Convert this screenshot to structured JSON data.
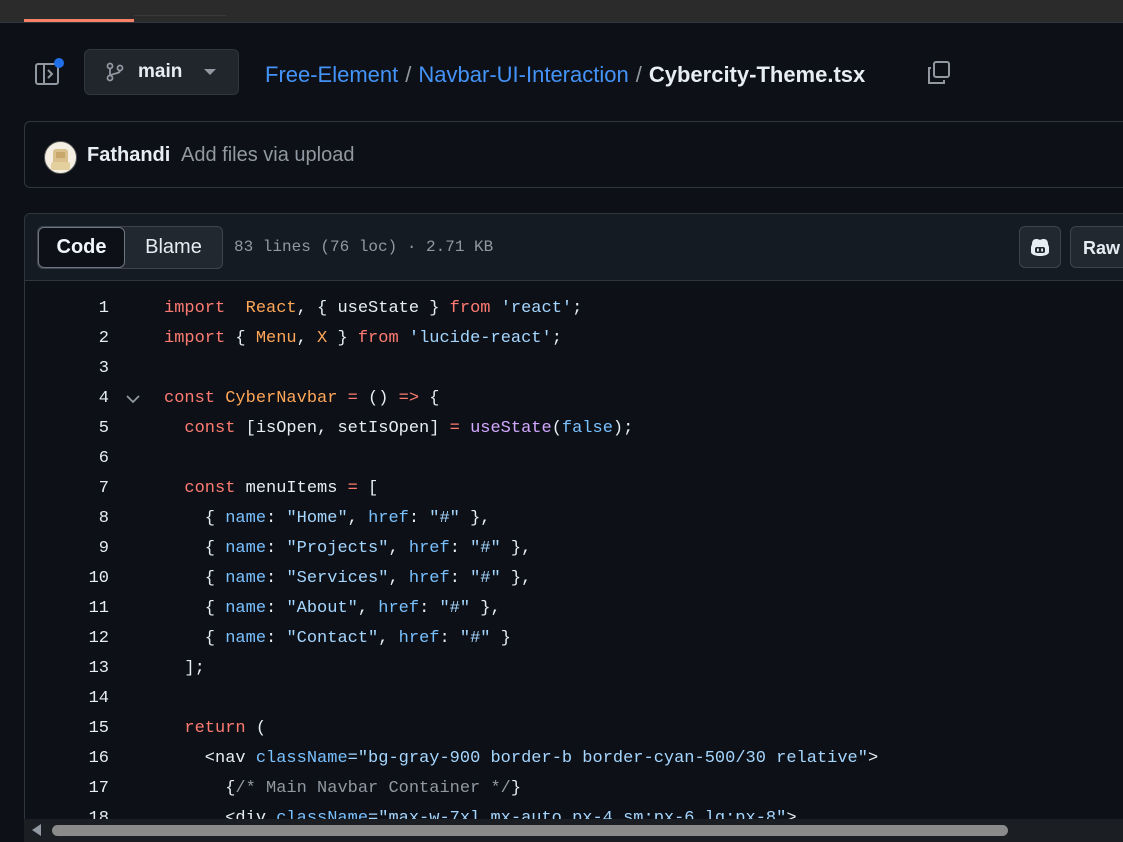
{
  "branch": {
    "name": "main"
  },
  "breadcrumb": {
    "repo": "Free-Element",
    "folder": "Navbar-UI-Interaction",
    "file": "Cybercity-Theme.tsx",
    "separator": "/"
  },
  "commit": {
    "author": "Fathandi",
    "message": "Add files via upload"
  },
  "file_header": {
    "tabs": [
      "Code",
      "Blame"
    ],
    "active_tab": "Code",
    "meta": "83 lines (76 loc) · 2.71 KB",
    "raw_label": "Raw"
  },
  "code": {
    "lines": [
      {
        "n": "1",
        "foldable": false,
        "tokens": [
          [
            "kw",
            "import"
          ],
          [
            "",
            "  "
          ],
          [
            "var",
            "React"
          ],
          [
            "",
            ", { useState } "
          ],
          [
            "kw",
            "from"
          ],
          [
            "",
            " "
          ],
          [
            "str",
            "'react'"
          ],
          [
            "",
            ";"
          ]
        ]
      },
      {
        "n": "2",
        "foldable": false,
        "tokens": [
          [
            "kw",
            "import"
          ],
          [
            "",
            " { "
          ],
          [
            "var",
            "Menu"
          ],
          [
            "",
            ", "
          ],
          [
            "var",
            "X"
          ],
          [
            "",
            " } "
          ],
          [
            "kw",
            "from"
          ],
          [
            "",
            " "
          ],
          [
            "str",
            "'lucide-react'"
          ],
          [
            "",
            ";"
          ]
        ]
      },
      {
        "n": "3",
        "foldable": false,
        "tokens": []
      },
      {
        "n": "4",
        "foldable": true,
        "tokens": [
          [
            "kw",
            "const"
          ],
          [
            "",
            " "
          ],
          [
            "var",
            "CyberNavbar"
          ],
          [
            "",
            " "
          ],
          [
            "kw",
            "="
          ],
          [
            "",
            " () "
          ],
          [
            "kw",
            "=>"
          ],
          [
            "",
            " {"
          ]
        ]
      },
      {
        "n": "5",
        "foldable": false,
        "tokens": [
          [
            "",
            "  "
          ],
          [
            "kw",
            "const"
          ],
          [
            "",
            " [isOpen, setIsOpen] "
          ],
          [
            "kw",
            "="
          ],
          [
            "",
            " "
          ],
          [
            "fn",
            "useState"
          ],
          [
            "",
            "("
          ],
          [
            "prop",
            "false"
          ],
          [
            "",
            ");"
          ]
        ]
      },
      {
        "n": "6",
        "foldable": false,
        "tokens": []
      },
      {
        "n": "7",
        "foldable": false,
        "tokens": [
          [
            "",
            "  "
          ],
          [
            "kw",
            "const"
          ],
          [
            "",
            " menuItems "
          ],
          [
            "kw",
            "="
          ],
          [
            "",
            " ["
          ]
        ]
      },
      {
        "n": "8",
        "foldable": false,
        "tokens": [
          [
            "",
            "    { "
          ],
          [
            "prop",
            "name"
          ],
          [
            "",
            ": "
          ],
          [
            "str",
            "\"Home\""
          ],
          [
            "",
            ", "
          ],
          [
            "prop",
            "href"
          ],
          [
            "",
            ": "
          ],
          [
            "str",
            "\"#\""
          ],
          [
            "",
            " },"
          ]
        ]
      },
      {
        "n": "9",
        "foldable": false,
        "tokens": [
          [
            "",
            "    { "
          ],
          [
            "prop",
            "name"
          ],
          [
            "",
            ": "
          ],
          [
            "str",
            "\"Projects\""
          ],
          [
            "",
            ", "
          ],
          [
            "prop",
            "href"
          ],
          [
            "",
            ": "
          ],
          [
            "str",
            "\"#\""
          ],
          [
            "",
            " },"
          ]
        ]
      },
      {
        "n": "10",
        "foldable": false,
        "tokens": [
          [
            "",
            "    { "
          ],
          [
            "prop",
            "name"
          ],
          [
            "",
            ": "
          ],
          [
            "str",
            "\"Services\""
          ],
          [
            "",
            ", "
          ],
          [
            "prop",
            "href"
          ],
          [
            "",
            ": "
          ],
          [
            "str",
            "\"#\""
          ],
          [
            "",
            " },"
          ]
        ]
      },
      {
        "n": "11",
        "foldable": false,
        "tokens": [
          [
            "",
            "    { "
          ],
          [
            "prop",
            "name"
          ],
          [
            "",
            ": "
          ],
          [
            "str",
            "\"About\""
          ],
          [
            "",
            ", "
          ],
          [
            "prop",
            "href"
          ],
          [
            "",
            ": "
          ],
          [
            "str",
            "\"#\""
          ],
          [
            "",
            " },"
          ]
        ]
      },
      {
        "n": "12",
        "foldable": false,
        "tokens": [
          [
            "",
            "    { "
          ],
          [
            "prop",
            "name"
          ],
          [
            "",
            ": "
          ],
          [
            "str",
            "\"Contact\""
          ],
          [
            "",
            ", "
          ],
          [
            "prop",
            "href"
          ],
          [
            "",
            ": "
          ],
          [
            "str",
            "\"#\""
          ],
          [
            "",
            " }"
          ]
        ]
      },
      {
        "n": "13",
        "foldable": false,
        "tokens": [
          [
            "",
            "  ];"
          ]
        ]
      },
      {
        "n": "14",
        "foldable": false,
        "tokens": []
      },
      {
        "n": "15",
        "foldable": false,
        "tokens": [
          [
            "",
            "  "
          ],
          [
            "kw",
            "return"
          ],
          [
            "",
            " ("
          ]
        ]
      },
      {
        "n": "16",
        "foldable": false,
        "tokens": [
          [
            "",
            "    <"
          ],
          [
            "",
            "nav"
          ],
          [
            "",
            " "
          ],
          [
            "prop",
            "className"
          ],
          [
            "kw",
            ""
          ],
          [
            "str",
            "=\"bg-gray-900 border-b border-cyan-500/30 relative\""
          ],
          [
            "",
            ">"
          ]
        ]
      },
      {
        "n": "17",
        "foldable": false,
        "tokens": [
          [
            "",
            "      {"
          ],
          [
            "cm",
            "/* Main Navbar Container */"
          ],
          [
            "",
            "}"
          ]
        ]
      },
      {
        "n": "18",
        "foldable": false,
        "tokens": [
          [
            "",
            "      <div "
          ],
          [
            "prop",
            "className"
          ],
          [
            "str",
            "=\"max-w-7xl mx-auto px-4 sm:px-6 lg:px-8\""
          ],
          [
            "",
            ">"
          ]
        ]
      }
    ]
  }
}
